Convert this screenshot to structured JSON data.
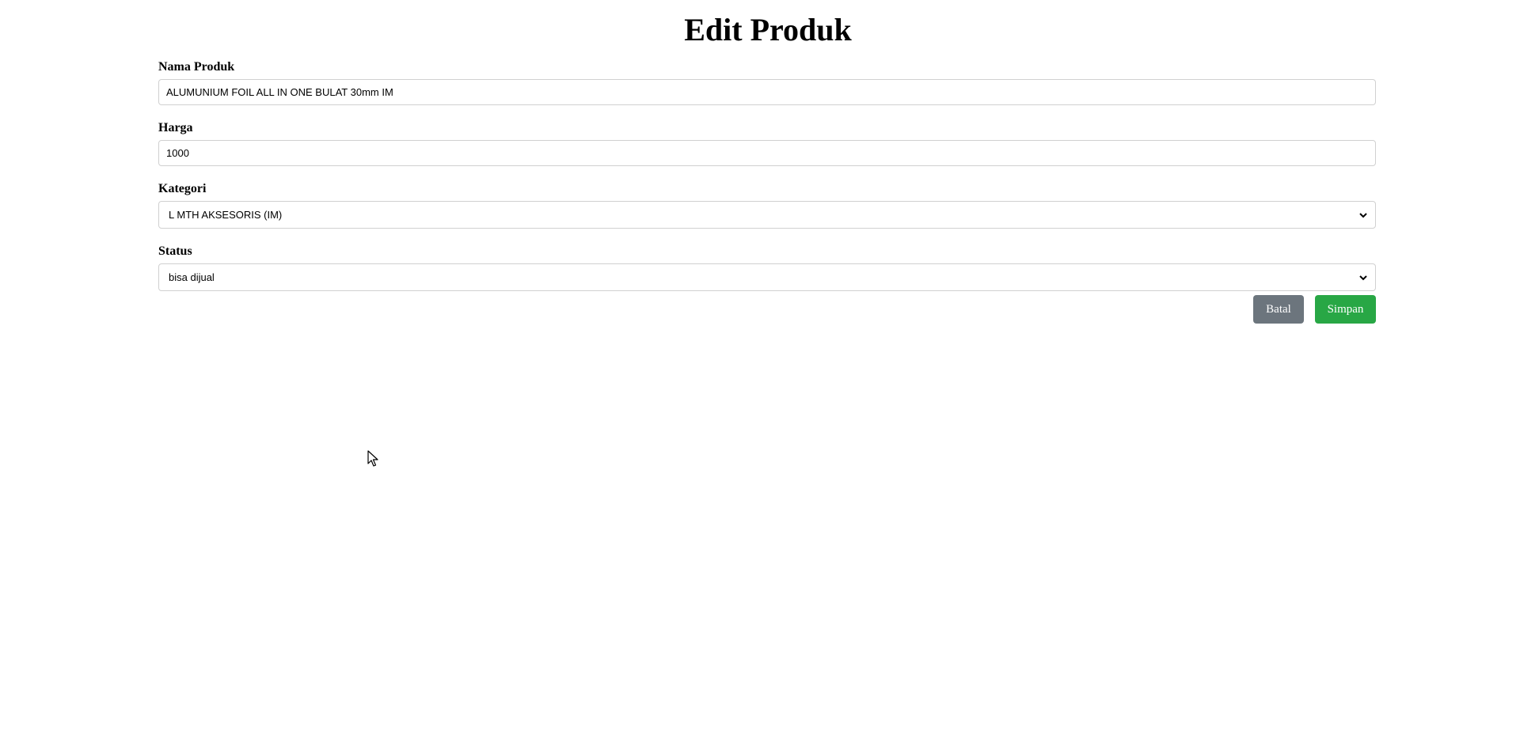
{
  "page": {
    "title": "Edit Produk"
  },
  "form": {
    "nama_produk": {
      "label": "Nama Produk",
      "value": "ALUMUNIUM FOIL ALL IN ONE BULAT 30mm IM"
    },
    "harga": {
      "label": "Harga",
      "value": "1000"
    },
    "kategori": {
      "label": "Kategori",
      "selected": "L MTH AKSESORIS (IM)"
    },
    "status": {
      "label": "Status",
      "selected": "bisa dijual"
    }
  },
  "actions": {
    "cancel_label": "Batal",
    "save_label": "Simpan"
  },
  "colors": {
    "cancel_button": "#6c757d",
    "save_button": "#28a745",
    "input_border": "#d0d0d0"
  },
  "icons": {
    "select_arrow": "chevron-down-icon",
    "cursor": "mouse-pointer-icon"
  }
}
